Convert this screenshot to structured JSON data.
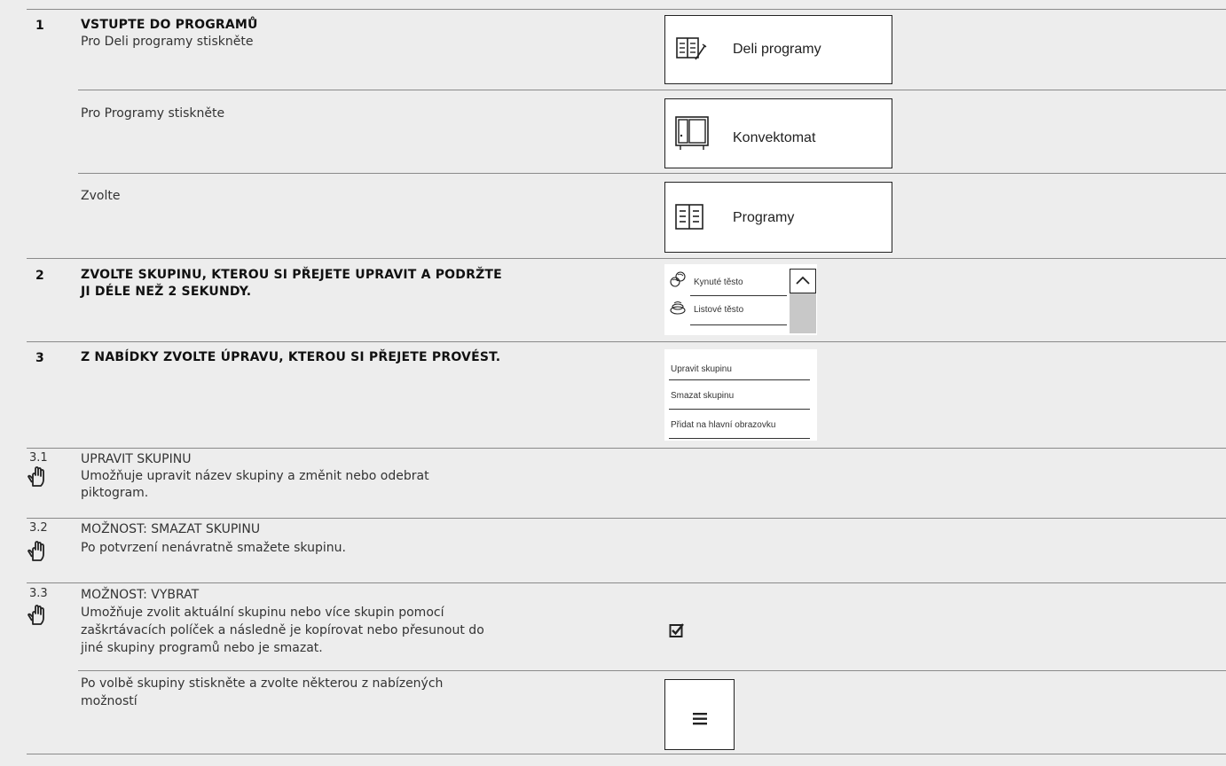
{
  "step1": {
    "num": "1",
    "title": "VSTUPTE DO PROGRAMŮ",
    "sub1": "Pro Deli programy stiskněte",
    "sub2": "Pro Programy stiskněte",
    "sub3": "Zvolte",
    "btn_deli": "Deli programy",
    "btn_konv": "Konvektomat",
    "btn_prog": "Programy"
  },
  "step2": {
    "num": "2",
    "title_line1": "ZVOLTE SKUPINU, KTEROU SI PŘEJETE UPRAVIT A PODRŽTE",
    "title_line2": "JI DÉLE NEŽ 2 SEKUNDY.",
    "list": [
      "Kynuté těsto",
      "Listové těsto"
    ]
  },
  "step3": {
    "num": "3",
    "title": "Z NABÍDKY ZVOLTE ÚPRAVU, KTEROU SI PŘEJETE PROVÉST.",
    "menu": [
      "Upravit skupinu",
      "Smazat skupinu",
      "Přidat na hlavní obrazovku"
    ]
  },
  "step31": {
    "num": "3.1",
    "title": "UPRAVIT SKUPINU",
    "line1": "Umožňuje upravit název skupiny a změnit nebo odebrat",
    "line2": "piktogram."
  },
  "step32": {
    "num": "3.2",
    "title": "MOŽNOST: SMAZAT SKUPINU",
    "line1": "Po potvrzení nenávratně smažete skupinu."
  },
  "step33": {
    "num": "3.3",
    "title": "MOŽNOST: VYBRAT",
    "line1": "Umožňuje zvolit aktuální skupinu nebo více skupin pomocí",
    "line2": "zaškrtávacích políček a následně je kopírovat nebo přesunout do",
    "line3": "jiné skupiny programů nebo je smazat.",
    "line4": "Po volbě skupiny stiskněte a zvolte některou z nabízených",
    "line5": "možností"
  }
}
